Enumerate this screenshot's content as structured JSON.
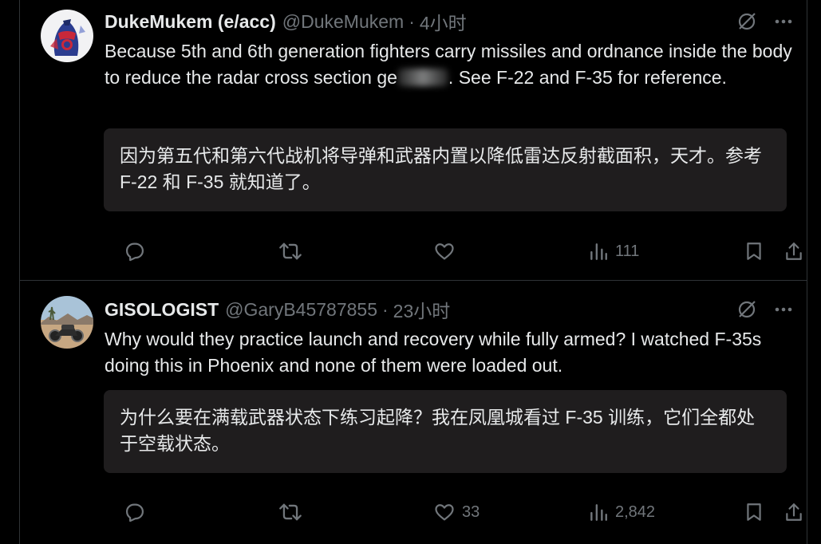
{
  "posts": [
    {
      "author_name": "DukeMukem (e/acc)",
      "handle": "@DukeMukem",
      "separator": "·",
      "time": "4小时",
      "text_before_blur": "Because 5th and 6th generation fighters carry missiles and ordnance inside the body to reduce the radar cross section ge",
      "text_after_blur": ". See F-22 and F-35 for reference.",
      "translation": "因为第五代和第六代战机将导弹和武器内置以降低雷达反射截面积，天才。参考 F-22 和 F-35 就知道了。",
      "likes": "",
      "views": "111",
      "avatar_icon": "captain-america-avatar"
    },
    {
      "author_name": "GISOLOGIST",
      "handle": "@GaryB45787855",
      "separator": "·",
      "time": "23小时",
      "text": "Why would they practice launch and recovery while fully armed? I watched F-35s doing this in Phoenix and none of them were loaded out.",
      "translation": "为什么要在满载武器状态下练习起降？我在凤凰城看过 F-35 训练，它们全都处于空载状态。",
      "likes": "33",
      "views": "2,842",
      "avatar_icon": "motorcycle-desert-avatar"
    }
  ],
  "colors": {
    "background": "#000000",
    "text_primary": "#e7e9ea",
    "text_secondary": "#71767b",
    "translation_bg": "#1f1d1e",
    "divider": "#2f3336"
  }
}
